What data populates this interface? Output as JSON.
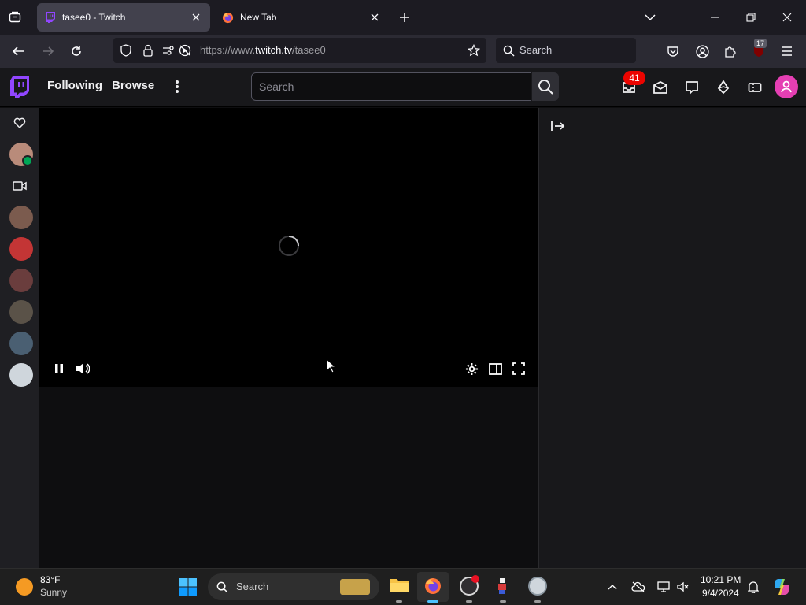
{
  "browser": {
    "tabs": [
      {
        "title": "tasee0 - Twitch",
        "active": true
      },
      {
        "title": "New Tab",
        "active": false
      }
    ],
    "url": {
      "prefix": "https://www.",
      "domain": "twitch.tv",
      "path": "/tasee0"
    },
    "search_placeholder": "Search",
    "extension_badge": "17"
  },
  "twitch": {
    "nav": {
      "following": "Following",
      "browse": "Browse"
    },
    "search_placeholder": "Search",
    "notification_count": "41",
    "brand_color": "#9146ff",
    "profile_color": "#e53fb3"
  },
  "sidebar": {
    "avatars": [
      {
        "name": "followed-channel-1",
        "color": "#b98b7a"
      },
      {
        "name": "followed-channel-2",
        "color": "#7b5b4e"
      },
      {
        "name": "followed-channel-3",
        "color": "#c33535"
      },
      {
        "name": "followed-channel-4",
        "color": "#6a3d3d"
      },
      {
        "name": "followed-channel-5",
        "color": "#5a5248"
      },
      {
        "name": "followed-channel-6",
        "color": "#4a5f72"
      },
      {
        "name": "followed-channel-7",
        "color": "#cfd6dc"
      }
    ]
  },
  "taskbar": {
    "weather_temp": "83°F",
    "weather_desc": "Sunny",
    "search_placeholder": "Search",
    "time": "10:21 PM",
    "date": "9/4/2024"
  }
}
